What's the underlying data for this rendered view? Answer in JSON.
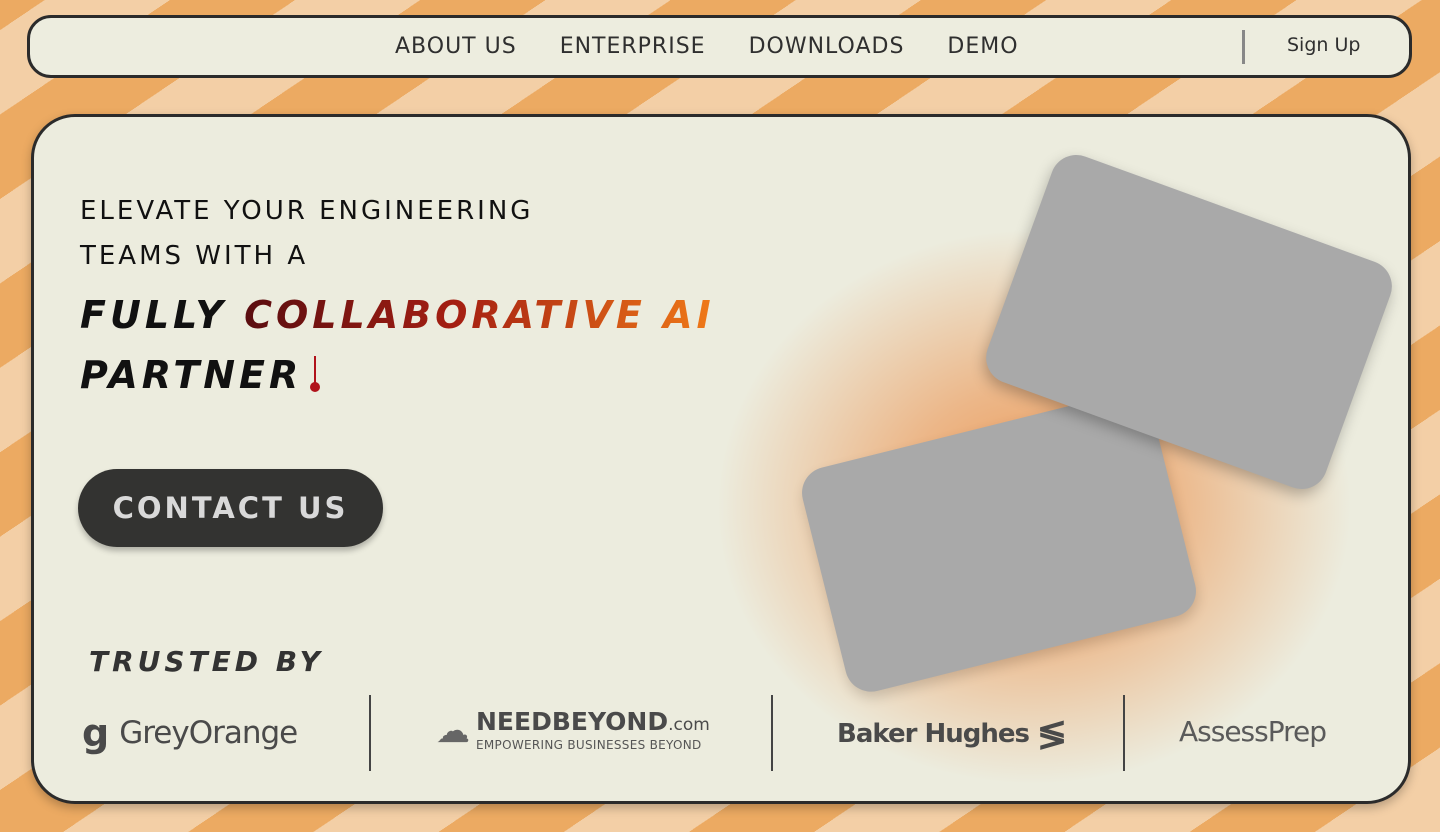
{
  "nav": {
    "links": [
      "ABOUT US",
      "ENTERPRISE",
      "DOWNLOADS",
      "DEMO"
    ],
    "signup_label": "Sign Up"
  },
  "hero": {
    "kicker_line1": "ELEVATE YOUR ENGINEERING",
    "kicker_line2": "TEAMS WITH A",
    "headline_word1": "FULLY",
    "headline_highlight": "COLLABORATIVE AI",
    "headline_word2": "PARTNER",
    "cta_label": "CONTACT US"
  },
  "trusted": {
    "label": "TRUSTED BY",
    "logos": {
      "greyorange": "GreyOrange",
      "needbeyond_main": "NEEDBEYOND",
      "needbeyond_domain": ".com",
      "needbeyond_tagline": "EMPOWERING BUSINESSES BEYOND",
      "bakerhughes": "Baker Hughes",
      "assessprep": "AssessPrep"
    }
  },
  "colors": {
    "accent_dark": "#5a0d10",
    "accent_red": "#a51f12",
    "accent_orange": "#f07a18",
    "button_bg": "#333331",
    "panel_bg": "#ececde"
  }
}
